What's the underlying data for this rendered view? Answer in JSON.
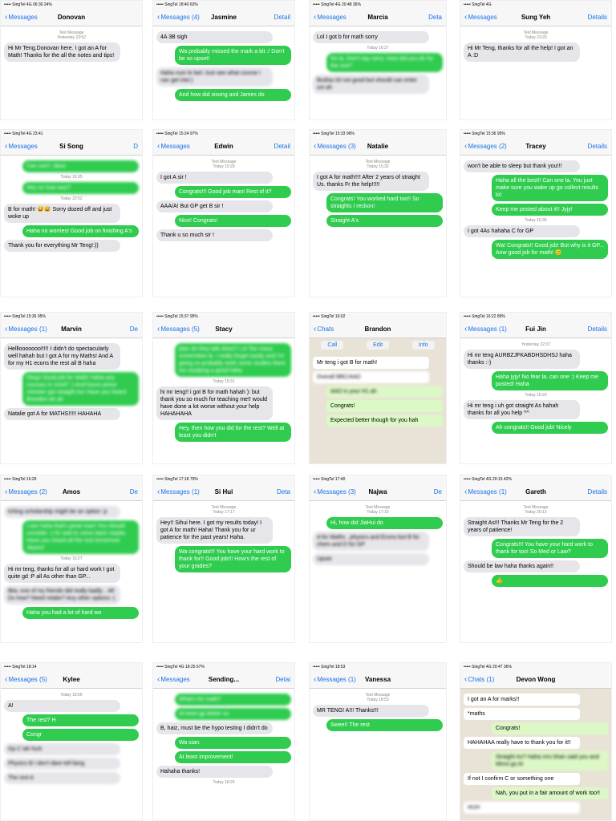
{
  "screens": [
    {
      "status": "••••• SingTel 4G   06:30   24%",
      "back": "Messages",
      "title": "Donovan",
      "details": "",
      "msgs": [
        {
          "t": "meta",
          "text": "Text Message\nYesterday 23:52"
        },
        {
          "t": "in",
          "text": "Hi Mr Teng,Donovan here. I got an A for Math! Thanks for the all the notes and tips!"
        }
      ]
    },
    {
      "status": "••••• SingTel   18:40   63%",
      "back": "Messages (4)",
      "title": "Jasmine",
      "details": "Detail",
      "msgs": [
        {
          "t": "in",
          "text": "4A 3B sigh"
        },
        {
          "t": "out",
          "text": "Wa probably missed the mark a bit :/ Don't be so upset!"
        },
        {
          "t": "in",
          "text": "Haha num le ba!! Just see what course I can get into:)",
          "blur": true
        },
        {
          "t": "out",
          "text": "And how did sisong and James do"
        }
      ]
    },
    {
      "status": "••••• SingTel 4G   20:48   36%",
      "back": "Messages",
      "title": "Marcia",
      "details": "Deta",
      "msgs": [
        {
          "t": "in",
          "text": "Lol I got b for math sorry"
        },
        {
          "t": "meta",
          "text": "Today 16:27"
        },
        {
          "t": "out",
          "text": "No la. Don't say sorry. How did you do for the rest?",
          "blur": true
        },
        {
          "t": "in",
          "text": "Bcd/as lol not good but should can enter uni ah",
          "blur": true
        }
      ]
    },
    {
      "status": "••••• SingTel 4G",
      "back": "Messages",
      "title": "Sung Yeh",
      "details": "Details",
      "msgs": [
        {
          "t": "meta",
          "text": "Text Message\nToday 23:29"
        },
        {
          "t": "in",
          "text": "Hi Mr Teng, thanks for all the help! I got an A :D"
        }
      ]
    },
    {
      "status": "••••• SingTel 4G   23:41",
      "back": "Messages",
      "title": "Si Song",
      "details": "D",
      "msgs": [
        {
          "t": "out",
          "text": "Can can!! :daus",
          "blur": true
        },
        {
          "t": "meta",
          "text": "Today 16:35"
        },
        {
          "t": "out",
          "text": "Hey so how was?",
          "blur": true
        },
        {
          "t": "meta",
          "text": "Today 22:52"
        },
        {
          "t": "in",
          "text": "B for math! 😅😅 Sorry dozed off and just woke up"
        },
        {
          "t": "out",
          "text": "Haha no worries! Good job on finishing A's"
        },
        {
          "t": "in",
          "text": "Thank you for everything Mr Teng!:))"
        }
      ]
    },
    {
      "status": "••••• SingTel   15:24   97%",
      "back": "Messages",
      "title": "Edwin",
      "details": "Detail",
      "msgs": [
        {
          "t": "meta",
          "text": "Text Message\nToday 15:20"
        },
        {
          "t": "in",
          "text": "I got A sir !"
        },
        {
          "t": "out",
          "text": "Congrats!!! Good job man! Rest of it?"
        },
        {
          "t": "in",
          "text": "AAA/A! But GP get B sir !"
        },
        {
          "t": "out",
          "text": "Nice! Congrats!"
        },
        {
          "t": "in",
          "text": "Thank u so much sir !"
        }
      ]
    },
    {
      "status": "••••• SingTel   15:33   96%",
      "back": "Messages (3)",
      "title": "Natalie",
      "details": "",
      "msgs": [
        {
          "t": "meta",
          "text": "Text Message\nToday 15:32"
        },
        {
          "t": "in",
          "text": "I got A for math!!!! After 2 years of straight Us. thanks Fr the help!!!!!"
        },
        {
          "t": "out",
          "text": "Congrats! You worked hard too!! So straights I reckon!"
        },
        {
          "t": "out",
          "text": "Straight A's"
        }
      ]
    },
    {
      "status": "••••• SingTel   15:36   95%",
      "back": "Messages (2)",
      "title": "Tracey",
      "details": "Details",
      "msgs": [
        {
          "t": "in",
          "text": "won't be able to sleep but thank you!!!"
        },
        {
          "t": "out",
          "text": "Haha all the best!! Can one la. You just make sure you wake up go collect results lol"
        },
        {
          "t": "out",
          "text": "Keep me posted about it!! Jyjy!"
        },
        {
          "t": "meta",
          "text": "Today 15:36"
        },
        {
          "t": "in",
          "text": "I got 4As hahaha C for GP"
        },
        {
          "t": "out",
          "text": "Wa! Congrats!! Good job! But why is it GP... Anw good job for math! 😊"
        }
      ]
    },
    {
      "status": "••••• SingTel   15:36   95%",
      "back": "Messages (1)",
      "title": "Marvin",
      "details": "De",
      "msgs": [
        {
          "t": "in",
          "text": "Helllooooooo!!!!! I didn't do spectacularly well hahah but I got A for my Maths! And A for my H1 econs the rest all B haha"
        },
        {
          "t": "out",
          "text": "Okay! Good job for Math! Haha any courses in mind? :) And future prime minister got straight As! Have you heard Brandon do ah",
          "blur": true
        },
        {
          "t": "in",
          "text": "Natalie got A for MATHS!!!!! HAHAHA"
        }
      ]
    },
    {
      "status": "••••• SingTel   15:37   95%",
      "back": "Messages (5)",
      "title": "Stacy",
      "details": "",
      "msgs": [
        {
          "t": "out",
          "text": "plan do they talk down? Lol Too many universities la. I really forget easily and I'm going so probably seek some studies there too studying a good haha",
          "blur": true
        },
        {
          "t": "meta",
          "text": "Today 15:31"
        },
        {
          "t": "in",
          "text": "hi mr teng!! i got B for math hahah ): but thank you so much for teaching me!! would have done a lot worse without your help HAHAHAHA"
        },
        {
          "t": "out",
          "text": "Hey, then how you did for the rest? Well at least you didn't"
        }
      ]
    },
    {
      "status": "••••• SingTel   16:02",
      "back": "Chats",
      "title": "Brandon",
      "details": "",
      "whatsapp": true,
      "tabs": [
        "Call",
        "Edit",
        "Info"
      ],
      "msgs": [
        {
          "t": "in",
          "text": "Mr teng i got B for math!"
        },
        {
          "t": "in",
          "text": "Overall BBC/AAD",
          "blur": true
        },
        {
          "t": "out",
          "text": "AAD is your H1 ah",
          "blur": true
        },
        {
          "t": "out",
          "text": "Congrats!"
        },
        {
          "t": "out",
          "text": "Expected better though for you hah"
        }
      ]
    },
    {
      "status": "••••• SingTel   16:22   89%",
      "back": "Messages (1)",
      "title": "Fui Jin",
      "details": "Details",
      "msgs": [
        {
          "t": "meta",
          "text": "Yesterday 22:37"
        },
        {
          "t": "in",
          "text": "Hi mr teng AURBZJFKABDHSDHSJ haha thanks :-)"
        },
        {
          "t": "out",
          "text": "Haha jyjy! No fear la, can one :) Keep me posted! Haha"
        },
        {
          "t": "meta",
          "text": "Today 15:20"
        },
        {
          "t": "in",
          "text": "Hi mr teng i uh got straight As hahah thanks for all you help ^^"
        },
        {
          "t": "out",
          "text": "Ah congrats!! Good job! Nicely"
        }
      ]
    },
    {
      "status": "••••• SingTel   16:29",
      "back": "Messages (2)",
      "title": "Amos",
      "details": "De",
      "msgs": [
        {
          "t": "in",
          "text": "tching scholarship might be an option :p",
          "blur": true
        },
        {
          "t": "out",
          "text": "I see haha that's great man! You should consider :) Or wait to come back maybe. Have you heard all the rest tomorrow! Jiayou!",
          "blur": true
        },
        {
          "t": "meta",
          "text": "Today 16:27"
        },
        {
          "t": "in",
          "text": "Hi mr teng, thanks for all ur hard work I got quite gd :P all As other than GP..."
        },
        {
          "t": "in",
          "text": "Btw, one of my friends did really badly... All Ds how? Need retake? Any other options :(",
          "blur": true
        },
        {
          "t": "out",
          "text": "Haha you had a lot of hard wo"
        }
      ]
    },
    {
      "status": "••••• SingTel   17:18   79%",
      "back": "Messages (1)",
      "title": "Si Hui",
      "details": "Deta",
      "msgs": [
        {
          "t": "meta",
          "text": "Text Message\nToday 17:17"
        },
        {
          "t": "in",
          "text": "Hey!! Sihui here. I got my results today! I got A for math! Haha! Thank you for ur patience for the past years! Haha."
        },
        {
          "t": "out",
          "text": "Wa congrats!!! You have your hard work to thank for!! Good job!!! How's the rest of your grades?"
        }
      ]
    },
    {
      "status": "••••• SingTel   17:40",
      "back": "Messages (3)",
      "title": "Najwa",
      "details": "De",
      "msgs": [
        {
          "t": "meta",
          "text": "Text Message\nToday 17:16"
        },
        {
          "t": "out",
          "text": "Hi, how did JiaHui do"
        },
        {
          "t": "in",
          "text": "A for Maths , physics and Econs but B for chem and D for GP",
          "blur": true
        },
        {
          "t": "in",
          "text": "Upset",
          "blur": true
        }
      ]
    },
    {
      "status": "••••• SingTel 4G   20:15   42%",
      "back": "Messages (1)",
      "title": "Gareth",
      "details": "Details",
      "msgs": [
        {
          "t": "meta",
          "text": "Text Message\nToday 20:12"
        },
        {
          "t": "in",
          "text": "Straight As!!! Thanks Mr Teng for the 2 years of patience!"
        },
        {
          "t": "out",
          "text": "Congrats!!! You have your hard work to thank for too! So Med or Law?"
        },
        {
          "t": "in",
          "text": "Should be law haha thanks again!!"
        },
        {
          "t": "out",
          "text": "👍"
        }
      ]
    },
    {
      "status": "••••• SingTel   18:14",
      "back": "Messages (5)",
      "title": "Kylee",
      "details": "",
      "msgs": [
        {
          "t": "meta",
          "text": "Today 18:06"
        },
        {
          "t": "in",
          "text": "A!"
        },
        {
          "t": "out",
          "text": "The rest? H"
        },
        {
          "t": "out",
          "text": "Congr"
        },
        {
          "t": "in",
          "text": "Gp C lah fuck",
          "blur": true
        },
        {
          "t": "in",
          "text": "Physics B I don't dare tell liang",
          "blur": true
        },
        {
          "t": "in",
          "text": "The rest A",
          "blur": true
        }
      ]
    },
    {
      "status": "••••• SingTel 4G   18:25   67%",
      "back": "Messages",
      "title": "Sending...",
      "details": "Detai",
      "msgs": [
        {
          "t": "out",
          "text": "What's for math?",
          "blur": true
        },
        {
          "t": "out",
          "text": "At least gp better so",
          "blur": true
        },
        {
          "t": "in",
          "text": "B, haiz, must be the hypo testing I didn't do"
        },
        {
          "t": "out",
          "text": "Wa sian."
        },
        {
          "t": "out",
          "text": "At least improvement!"
        },
        {
          "t": "in",
          "text": "Hahaha thanks!"
        },
        {
          "t": "meta",
          "text": "Today 18:24"
        }
      ]
    },
    {
      "status": "••••• SingTel   18:53",
      "back": "Messages (1)",
      "title": "Vanessa",
      "details": "",
      "msgs": [
        {
          "t": "meta",
          "text": "Text Message\nToday 18:53"
        },
        {
          "t": "in",
          "text": "MR TENG! A!!! Thanks!!!"
        },
        {
          "t": "out",
          "text": "Swee!! The rest"
        }
      ]
    },
    {
      "status": "••••• SingTel 4G   20:47   36%",
      "back": "Chats (1)",
      "title": "Devon Wong",
      "details": "",
      "whatsapp": true,
      "msgs": [
        {
          "t": "in",
          "text": "I got an A for marks!!"
        },
        {
          "t": "in",
          "text": "*maths"
        },
        {
          "t": "out",
          "text": "Congrats!"
        },
        {
          "t": "in",
          "text": "HAHAHAA really have to thank you for it!!"
        },
        {
          "t": "out",
          "text": "Straight As? Haha mrs khan said you and Minni go A!",
          "blur": true
        },
        {
          "t": "in",
          "text": "If not I confirm C or something one"
        },
        {
          "t": "out",
          "text": "Nah, you put in a fair amount of work too!!"
        },
        {
          "t": "in",
          "text": "HUH",
          "blur": true
        }
      ]
    }
  ]
}
